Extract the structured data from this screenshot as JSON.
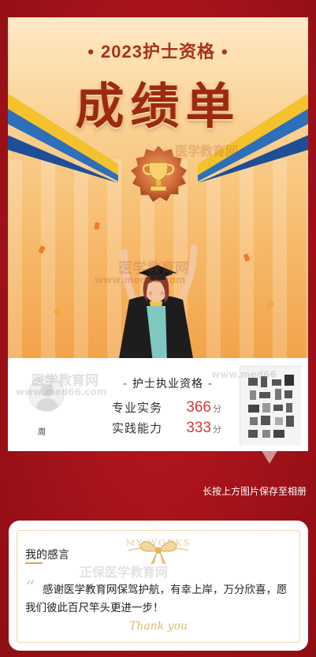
{
  "certificate": {
    "year_title": "2023护士资格",
    "main_title": "成绩单",
    "exam_name": "护士执业资格",
    "avatar_name": "周",
    "scores": [
      {
        "label": "专业实务",
        "value": "366",
        "unit": "分"
      },
      {
        "label": "实践能力",
        "value": "333",
        "unit": "分"
      }
    ],
    "watermark_cn": "医学教育网",
    "watermark_url": "www.med66.com",
    "watermark_url_short": "www.med66"
  },
  "save_tip": "长按上方图片保存至相册",
  "message_card": {
    "title": "我的感言",
    "header_deco": "MY WORKS",
    "text": "感谢医学教育网保驾护航，有幸上岸，万分欣喜，愿我们彼此百尺竿头更进一步！",
    "signature": "Thank you",
    "quote": "“",
    "watermark": "正保医学教育网"
  },
  "colors": {
    "page_bg": "#a8141a",
    "title": "#9c2a10",
    "score": "#d13a3a",
    "gold": "#e0b874"
  }
}
